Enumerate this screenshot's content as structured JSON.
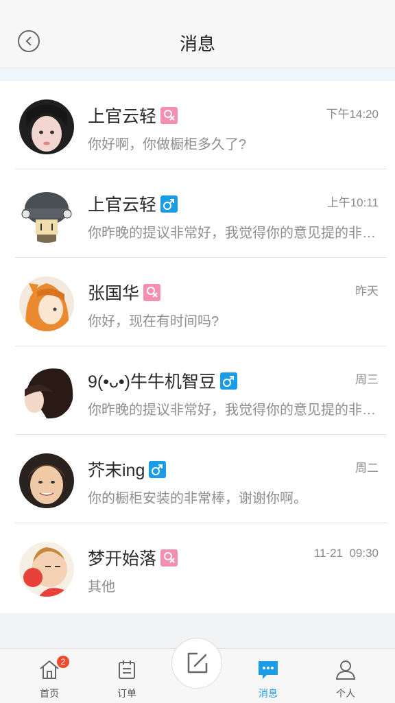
{
  "header": {
    "title": "消息"
  },
  "messages": [
    {
      "name": "上官云轻",
      "gender": "female",
      "time": "下午14:20",
      "preview": "你好啊，你做橱柜多久了?"
    },
    {
      "name": "上官云轻",
      "gender": "male",
      "time": "上午10:11",
      "preview": "你昨晚的提议非常好，我觉得你的意见提的非常好"
    },
    {
      "name": "张国华",
      "gender": "female",
      "time": "昨天",
      "preview": "你好，现在有时间吗?"
    },
    {
      "name": "9(•ᴗ•)牛牛机智豆",
      "gender": "male",
      "time": "周三",
      "preview": "你昨晚的提议非常好，我觉得你的意见提的非常好"
    },
    {
      "name": "芥末ing",
      "gender": "male",
      "time": "周二",
      "preview": "你的橱柜安装的非常棒，谢谢你啊。"
    },
    {
      "name": "梦开始落",
      "gender": "female",
      "time": "11-21  09:30",
      "preview": "其他"
    }
  ],
  "tabbar": {
    "home": {
      "label": "首页",
      "badge": "2"
    },
    "orders": {
      "label": "订单"
    },
    "messages": {
      "label": "消息"
    },
    "profile": {
      "label": "个人"
    }
  },
  "colors": {
    "accent": "#1a9ce6",
    "female": "#f58fb2",
    "badge": "#f04a2c"
  }
}
